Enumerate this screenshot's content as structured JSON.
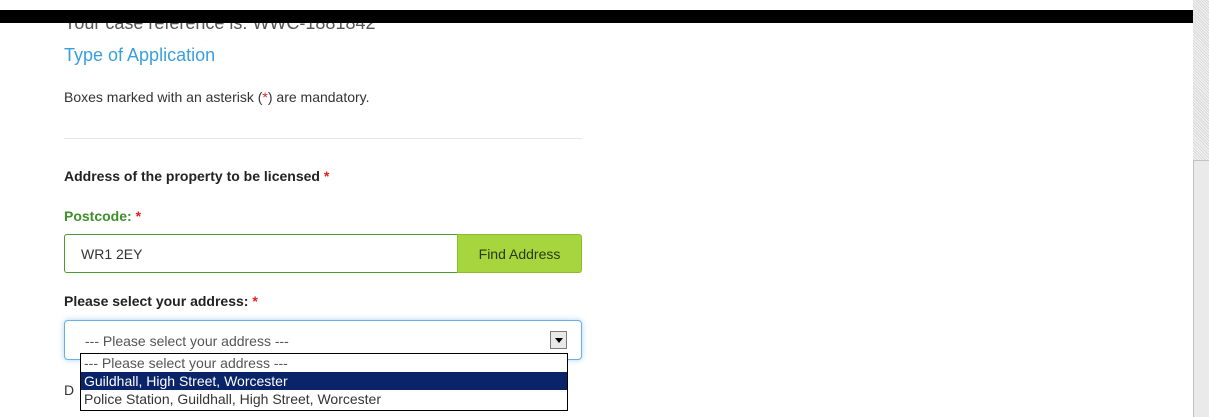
{
  "page": {
    "case_reference": "Your case reference is: WWC-1881842",
    "section_title": "Type of Application",
    "mandatory_note_before": "Boxes marked with an asterisk (",
    "mandatory_note_asterisk": "*",
    "mandatory_note_after": ") are mandatory."
  },
  "form": {
    "address_section_label": "Address of the property to be licensed",
    "postcode_label": "Postcode:",
    "postcode_value": "WR1 2EY",
    "find_address_button": "Find Address",
    "select_address_label": "Please select your address:",
    "required_marker": "*",
    "select_current_value": "--- Please select your address ---",
    "options": [
      "--- Please select your address ---",
      "Guildhall, High Street, Worcester",
      "Police Station, Guildhall, High Street, Worcester"
    ],
    "highlighted_option_index": 1,
    "partially_hidden_text": "D"
  },
  "colors": {
    "link_blue": "#3aa0dc",
    "required_red": "#e02020",
    "postcode_green": "#3f8f2a",
    "button_lime": "#a7d53e",
    "highlight_navy": "#0a246a",
    "focus_blue": "#66afe9"
  },
  "icons": {
    "select_arrow": "chevron-down-icon"
  }
}
